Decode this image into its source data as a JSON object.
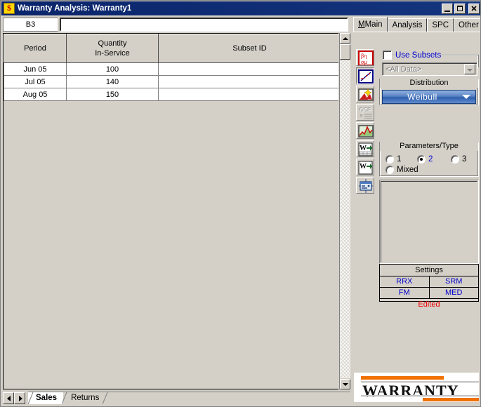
{
  "window": {
    "title": "Warranty Analysis: Warranty1",
    "app_icon": "dollar-sign-icon",
    "controls": {
      "minimize": "_",
      "maximize": "□",
      "close": "✕"
    }
  },
  "formula_bar": {
    "cell_reference": "B3",
    "formula_value": "",
    "formula_placeholder": ""
  },
  "sheet": {
    "columns": [
      "Period",
      "Quantity\nIn-Service",
      "Subset ID"
    ],
    "column_labels": {
      "period": "Period",
      "quantity_line1": "Quantity",
      "quantity_line2": "In-Service",
      "subset_id": "Subset ID"
    },
    "rows": [
      {
        "period": "Jun 05",
        "quantity": "100",
        "subset_id": ""
      },
      {
        "period": "Jul 05",
        "quantity": "140",
        "subset_id": ""
      },
      {
        "period": "Aug 05",
        "quantity": "150",
        "subset_id": ""
      }
    ],
    "selected_cell": "B3"
  },
  "sheet_tabs": {
    "nav_first": "◄",
    "nav_last": "►",
    "tabs": [
      {
        "label": "Sales",
        "active": true
      },
      {
        "label": "Returns",
        "active": false
      }
    ]
  },
  "right_panel": {
    "tabs": [
      {
        "label": "Main",
        "active": true
      },
      {
        "label": "Analysis",
        "active": false
      },
      {
        "label": "SPC",
        "active": false
      },
      {
        "label": "Other",
        "active": false
      }
    ],
    "toolbar": [
      {
        "name": "calculate-parameters-icon",
        "tooltip": "Calculate",
        "state": "normal"
      },
      {
        "name": "plot-icon",
        "tooltip": "Plot",
        "state": "pressed"
      },
      {
        "name": "quick-calculation-pad-plot-icon",
        "tooltip": "Plot Wizard",
        "state": "normal"
      },
      {
        "name": "qcp-icon",
        "tooltip": "QCP",
        "state": "disabled"
      },
      {
        "name": "function-chart-icon",
        "tooltip": "Chart",
        "state": "normal"
      },
      {
        "name": "word-report-icon",
        "tooltip": "Report",
        "state": "normal"
      },
      {
        "name": "word-document-icon",
        "tooltip": "Document",
        "state": "normal"
      },
      {
        "name": "data-sheet-icon",
        "tooltip": "Data Sheet",
        "state": "normal"
      }
    ],
    "subsets": {
      "checkbox_label": "Use Subsets",
      "checked": false,
      "combo_value": "<All Data>",
      "combo_enabled": false
    },
    "distribution": {
      "group_title": "Distribution",
      "selected": "Weibull"
    },
    "parameters": {
      "group_title": "Parameters/Type",
      "options": [
        {
          "label": "1",
          "selected": false
        },
        {
          "label": "2",
          "selected": true
        },
        {
          "label": "3",
          "selected": false
        },
        {
          "label": "Mixed",
          "selected": false
        }
      ]
    },
    "settings": {
      "title": "Settings",
      "cells": [
        "RRX",
        "SRM",
        "FM",
        "MED"
      ],
      "status": "Edited"
    },
    "logo": {
      "text": "WARRANTY"
    }
  },
  "colors": {
    "titlebar": "#0a246a",
    "face": "#d4d0c8",
    "link_blue": "#0000cc",
    "status_red": "#ee0000",
    "accent_orange": "#f07000",
    "dist_blue": "#2e5fae"
  }
}
